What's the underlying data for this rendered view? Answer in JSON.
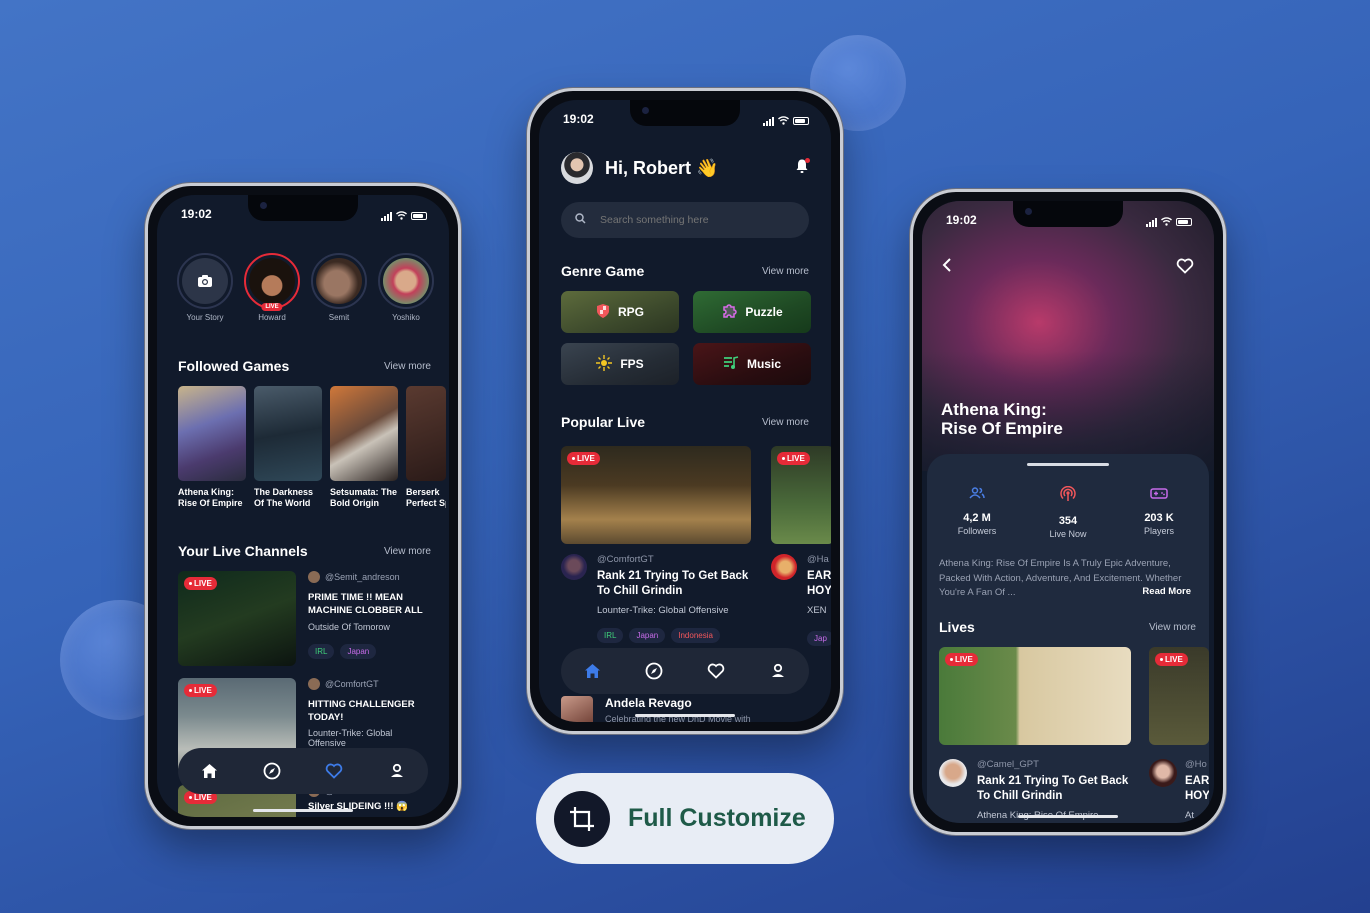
{
  "statusbar": {
    "time": "19:02"
  },
  "phone1": {
    "stories": [
      {
        "name": "Your Story",
        "type": "add",
        "live": false
      },
      {
        "name": "Howard",
        "type": "user",
        "live": true
      },
      {
        "name": "Semit",
        "type": "user",
        "live": false
      },
      {
        "name": "Yoshiko",
        "type": "user",
        "live": false
      }
    ],
    "live_label": "LIVE",
    "followed_games": {
      "title": "Followed Games",
      "view_more": "View more",
      "items": [
        {
          "name": "Athena King: Rise Of Empire"
        },
        {
          "name": "The Darkness Of The World"
        },
        {
          "name": "Setsumata: The Bold Origin"
        },
        {
          "name": "Berserk Perfect Spot"
        }
      ]
    },
    "live_channels": {
      "title": "Your Live Channels",
      "view_more": "View more",
      "items": [
        {
          "user": "@Semit_andreson",
          "title": "PRIME TIME !! MEAN MACHINE CLOBBER ALL",
          "game": "Outside Of Tomorow",
          "tags": [
            "IRL",
            "Japan"
          ]
        },
        {
          "user": "@ComfortGT",
          "title": "HITTING CHALLENGER TODAY!",
          "game": "Lounter-Trike: Global Offensive",
          "tags": []
        },
        {
          "user": "@ComfortGT",
          "title": "Silver SLIDEING !!! 😱",
          "game": "",
          "tags": []
        }
      ]
    },
    "nav_active": "favorites"
  },
  "phone2": {
    "greeting": "Hi, Robert 👋",
    "search_placeholder": "Search something here",
    "genre": {
      "title": "Genre Game",
      "view_more": "View more",
      "items": [
        {
          "label": "RPG",
          "icon": "shield-icon",
          "color": "#f2575b"
        },
        {
          "label": "Puzzle",
          "icon": "puzzle-icon",
          "color": "#d86be8"
        },
        {
          "label": "FPS",
          "icon": "crosshair-icon",
          "color": "#f3c623"
        },
        {
          "label": "Music",
          "icon": "music-icon",
          "color": "#3fcf7a"
        }
      ]
    },
    "popular_live": {
      "title": "Popular Live",
      "view_more": "View more",
      "items": [
        {
          "user": "@ComfortGT",
          "title": "Rank 21 Trying To Get Back To Chill Grindin",
          "game": "Lounter-Trike: Global Offensive",
          "tags": [
            "IRL",
            "Japan",
            "Indonesia"
          ]
        },
        {
          "user": "@Ha",
          "title": "EAR HOY",
          "game": "XEN",
          "tags": [
            "Jap"
          ]
        }
      ]
    },
    "next_item": {
      "name": "Andela Revago",
      "caption": "Celebrating the new DnD Movie with"
    },
    "nav_active": "home"
  },
  "phone3": {
    "game_title": "Athena King: Rise Of Empire",
    "stats": [
      {
        "value": "4,2 M",
        "label": "Followers",
        "icon": "users-icon",
        "color": "#4a7fe6"
      },
      {
        "value": "354",
        "label": "Live Now",
        "icon": "broadcast-icon",
        "color": "#f2575b"
      },
      {
        "value": "203 K",
        "label": "Players",
        "icon": "gamepad-icon",
        "color": "#c66be8"
      }
    ],
    "description": "Athena King: Rise Of Empire Is A Truly Epic Adventure, Packed With Action, Adventure, And Excitement. Whether You're A Fan Of ...",
    "read_more": "Read More",
    "lives": {
      "title": "Lives",
      "view_more": "View more",
      "items": [
        {
          "user": "@Camel_GPT",
          "title": "Rank 21 Trying To Get Back To Chill Grindin",
          "game": "Athena King: Rise Of Empire"
        },
        {
          "user": "@Ho",
          "title": "EAR HOY",
          "game": "At"
        }
      ]
    }
  },
  "badge": {
    "label": "Full Customize",
    "icon": "crop-icon"
  },
  "colors": {
    "accent": "#3d7be8",
    "live": "#e62b38",
    "bg_dark": "#111a2b",
    "badge_text": "#1e5a48"
  }
}
